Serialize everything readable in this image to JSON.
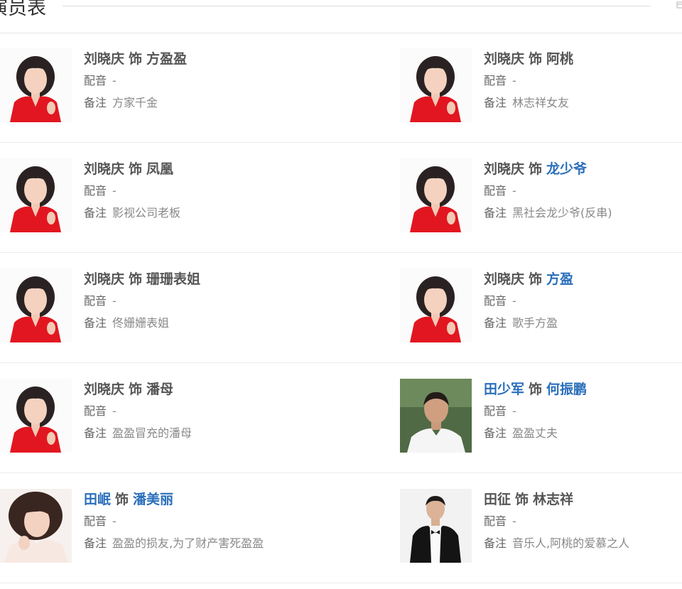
{
  "section": {
    "title": "演员表"
  },
  "labels": {
    "role_connector": "饰",
    "voice": "配音",
    "note": "备注"
  },
  "colors": {
    "link": "#2a6ebb",
    "name_text": "#555555",
    "meta_text": "#888888",
    "divider": "#ececec"
  },
  "cast": [
    {
      "actor": "刘晓庆",
      "actor_linked": false,
      "role": "方盈盈",
      "role_linked": false,
      "voice": "-",
      "note": "方家千金",
      "photo": "actress-red-dress-photo"
    },
    {
      "actor": "刘晓庆",
      "actor_linked": false,
      "role": "阿桃",
      "role_linked": false,
      "voice": "-",
      "note": "林志祥女友",
      "photo": "actress-red-dress-photo"
    },
    {
      "actor": "刘晓庆",
      "actor_linked": false,
      "role": "凤凰",
      "role_linked": false,
      "voice": "-",
      "note": "影视公司老板",
      "photo": "actress-red-dress-photo"
    },
    {
      "actor": "刘晓庆",
      "actor_linked": false,
      "role": "龙少爷",
      "role_linked": true,
      "voice": "-",
      "note": "黑社会龙少爷(反串)",
      "photo": "actress-red-dress-photo"
    },
    {
      "actor": "刘晓庆",
      "actor_linked": false,
      "role": "珊珊表姐",
      "role_linked": false,
      "voice": "-",
      "note": "佟姗姗表姐",
      "photo": "actress-red-dress-photo"
    },
    {
      "actor": "刘晓庆",
      "actor_linked": false,
      "role": "方盈",
      "role_linked": true,
      "voice": "-",
      "note": "歌手方盈",
      "photo": "actress-red-dress-photo"
    },
    {
      "actor": "刘晓庆",
      "actor_linked": false,
      "role": "潘母",
      "role_linked": false,
      "voice": "-",
      "note": "盈盈冒充的潘母",
      "photo": "actress-red-dress-photo"
    },
    {
      "actor": "田少军",
      "actor_linked": true,
      "role": "何振鹏",
      "role_linked": true,
      "voice": "-",
      "note": "盈盈丈夫",
      "photo": "actor-white-tshirt-photo"
    },
    {
      "actor": "田岷",
      "actor_linked": true,
      "role": "潘美丽",
      "role_linked": true,
      "voice": "-",
      "note": "盈盈的损友,为了财产害死盈盈",
      "photo": "actress-curly-hair-photo"
    },
    {
      "actor": "田征",
      "actor_linked": false,
      "role": "林志祥",
      "role_linked": false,
      "voice": "-",
      "note": "音乐人,阿桃的爱慕之人",
      "photo": "actor-tuxedo-photo"
    }
  ]
}
